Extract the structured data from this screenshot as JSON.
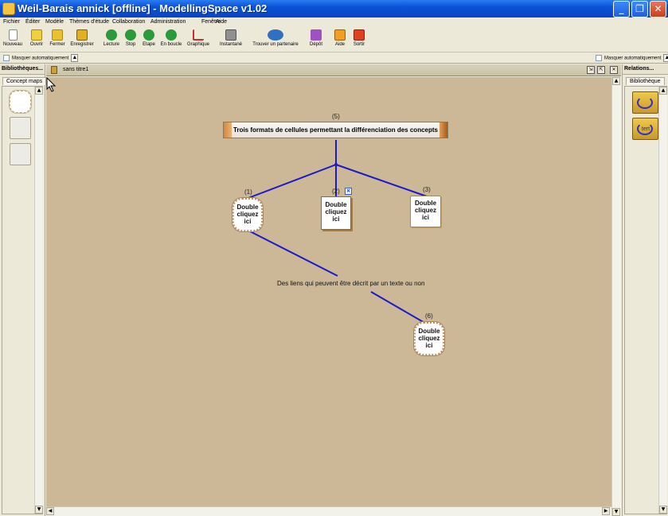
{
  "window": {
    "title": "Weil-Barais annick [offline] - ModellingSpace v1.02",
    "min_label": "_",
    "max_label": "❐",
    "close_label": "✕"
  },
  "menu": [
    "Fichier",
    "Éditer",
    "Modèle",
    "Thèmes d'étude",
    "Collaboration",
    "Administration",
    "Fenêtre",
    "Aide"
  ],
  "toolbar": [
    {
      "label": "Nouveau",
      "icon": "new-file-icon",
      "color": "#ffffff"
    },
    {
      "label": "Ouvrir",
      "icon": "open-folder-icon",
      "color": "#f0d040"
    },
    {
      "label": "Fermer",
      "icon": "close-folder-icon",
      "color": "#e8c030"
    },
    {
      "label": "Enregistrer",
      "icon": "save-icon",
      "color": "#e0b020"
    },
    {
      "label": "Lecture",
      "icon": "play-icon",
      "color": "#2a9a3a"
    },
    {
      "label": "Stop",
      "icon": "stop-icon",
      "color": "#2a9a3a"
    },
    {
      "label": "Etape",
      "icon": "step-icon",
      "color": "#2a9a3a"
    },
    {
      "label": "En boucle",
      "icon": "loop-icon",
      "color": "#2a9a3a"
    },
    {
      "label": "Graphique",
      "icon": "graph-icon",
      "color": "#c03030"
    },
    {
      "label": "Instantané",
      "icon": "snapshot-icon",
      "color": "#909090"
    },
    {
      "label": "Trouver un partenaire",
      "icon": "partner-icon",
      "color": "#3070c0"
    },
    {
      "label": "Dépôt",
      "icon": "depot-icon",
      "color": "#a050c0"
    },
    {
      "label": "Aide",
      "icon": "help-icon",
      "color": "#f0a020"
    },
    {
      "label": "Sortir",
      "icon": "exit-icon",
      "color": "#e04020"
    }
  ],
  "hidebar": {
    "left_label": "Masquer automatiquement",
    "right_label": "Masquer automatiquement"
  },
  "left_panel": {
    "header": "Bibliothèques...",
    "tab": "Concept maps"
  },
  "right_panel": {
    "header": "Relations...",
    "tab": "Bibliothèque",
    "item2_text": "tert"
  },
  "document": {
    "tab_title": "sans titre1"
  },
  "map": {
    "title_node": {
      "number": "(5)",
      "text": "Trois formats de cellules permettant la différenciation des concepts"
    },
    "nodes": [
      {
        "number": "(1)",
        "text": "Double cliquez ici",
        "shape": "cloud"
      },
      {
        "number": "(2)",
        "text": "Double cliquez ici",
        "shape": "box"
      },
      {
        "number": "(3)",
        "text": "Double cliquez ici",
        "shape": "rect"
      },
      {
        "number": "(6)",
        "text": "Double cliquez ici",
        "shape": "cloud"
      }
    ],
    "link_text": "Des liens qui peuvent être décrit par un texte ou non",
    "link_color": "#1a1acc",
    "canvas_color": "#ccb797"
  }
}
